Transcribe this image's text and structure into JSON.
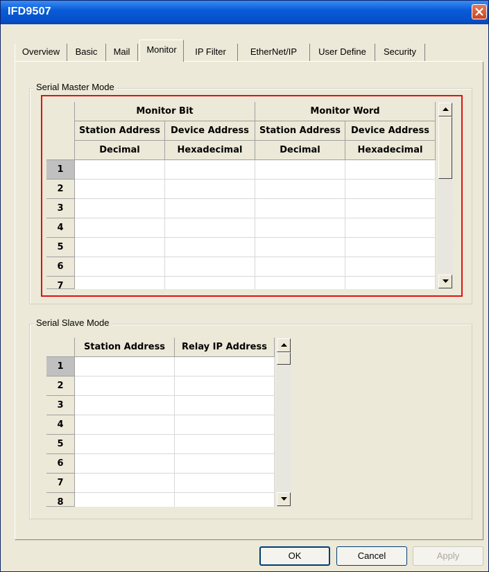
{
  "window": {
    "title": "IFD9507"
  },
  "tabs": [
    "Overview",
    "Basic",
    "Mail",
    "Monitor",
    "IP Filter",
    "EtherNet/IP",
    "User Define",
    "Security"
  ],
  "active_tab": "Monitor",
  "master": {
    "group_label": "Serial Master Mode",
    "header_group": [
      "Monitor Bit",
      "Monitor Word"
    ],
    "header_cols": [
      "Station Address",
      "Device Address",
      "Station Address",
      "Device Address"
    ],
    "header_formats": [
      "Decimal",
      "Hexadecimal",
      "Decimal",
      "Hexadecimal"
    ],
    "rows": [
      "1",
      "2",
      "3",
      "4",
      "5",
      "6",
      "7"
    ]
  },
  "slave": {
    "group_label": "Serial Slave Mode",
    "header_cols": [
      "Station Address",
      "Relay IP Address"
    ],
    "rows": [
      "1",
      "2",
      "3",
      "4",
      "5",
      "6",
      "7",
      "8"
    ]
  },
  "buttons": {
    "ok": "OK",
    "cancel": "Cancel",
    "apply": "Apply"
  },
  "colors": {
    "highlight_border": "#e01010",
    "title_bar": "#0a5bd8"
  }
}
